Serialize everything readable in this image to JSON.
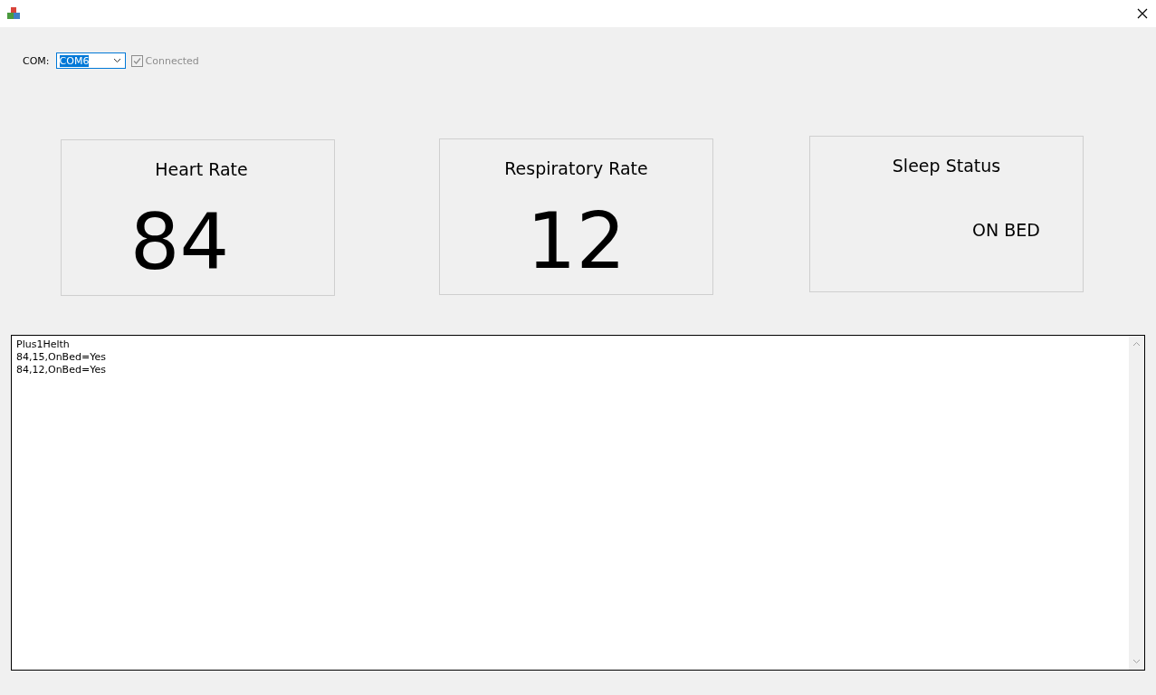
{
  "toolbar": {
    "port_label": "COM:",
    "port_select": {
      "value": "COM6",
      "focused": true
    },
    "connected_checkbox": {
      "label": "Connected",
      "checked": true,
      "disabled": true
    }
  },
  "cards": [
    {
      "title": "Heart Rate",
      "value": "84",
      "kind": "number"
    },
    {
      "title": "Respiratory Rate",
      "value": "12",
      "kind": "number"
    },
    {
      "title": "Sleep Status",
      "value": "ON BED",
      "kind": "status"
    }
  ],
  "log": {
    "lines": [
      "Plus1Helth",
      "84,15,OnBed=Yes",
      "84,12,OnBed=Yes"
    ]
  }
}
